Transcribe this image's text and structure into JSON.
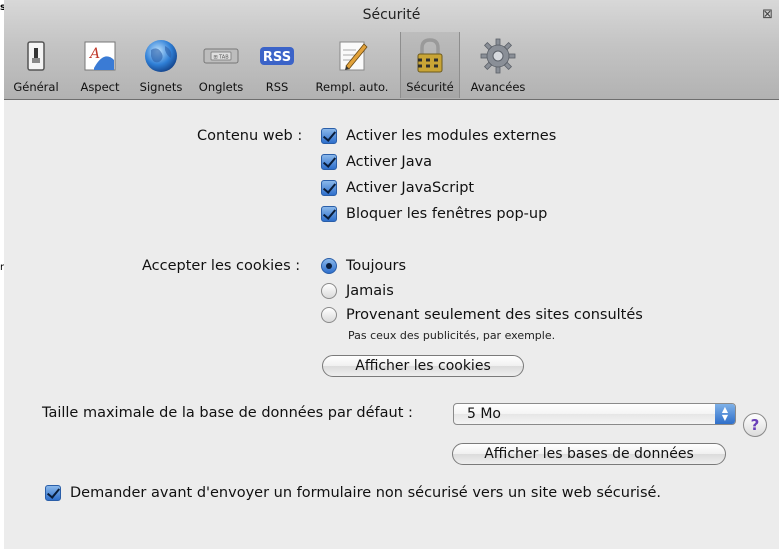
{
  "window": {
    "title": "Sécurité"
  },
  "edge": {
    "char1": "s",
    "char2": "r"
  },
  "toolbar": {
    "items": [
      {
        "label": "Général",
        "icon": "general-switch-icon"
      },
      {
        "label": "Aspect",
        "icon": "aspect-font-icon"
      },
      {
        "label": "Signets",
        "icon": "globe-icon"
      },
      {
        "label": "Onglets",
        "icon": "tabs-icon"
      },
      {
        "label": "RSS",
        "icon": "rss-icon"
      },
      {
        "label": "Rempl. auto.",
        "icon": "pencil-form-icon"
      },
      {
        "label": "Sécurité",
        "icon": "lock-icon",
        "selected": true
      },
      {
        "label": "Avancées",
        "icon": "gear-icon"
      }
    ],
    "rss_badge": "RSS",
    "tab_badge": "⊞ TAB"
  },
  "web_content": {
    "label": "Contenu web :",
    "options": [
      {
        "label": "Activer les modules externes",
        "checked": true
      },
      {
        "label": "Activer Java",
        "checked": true
      },
      {
        "label": "Activer JavaScript",
        "checked": true
      },
      {
        "label": "Bloquer les fenêtres pop-up",
        "checked": true
      }
    ]
  },
  "cookies": {
    "label": "Accepter les cookies :",
    "options": [
      {
        "label": "Toujours",
        "selected": true
      },
      {
        "label": "Jamais",
        "selected": false
      },
      {
        "label": "Provenant seulement des sites consultés",
        "selected": false
      }
    ],
    "note": "Pas ceux des publicités, par exemple.",
    "show_button": "Afficher les cookies"
  },
  "database": {
    "label": "Taille maximale de la base de données par défaut :",
    "selected_value": "5 Mo",
    "show_button": "Afficher les bases de données"
  },
  "insecure_form": {
    "label": "Demander avant d'envoyer un formulaire non sécurisé vers un site web sécurisé.",
    "checked": true
  },
  "help": {
    "label": "?"
  },
  "colors": {
    "accent_blue": "#2e6fcc",
    "window_bg": "#ececec",
    "help_purple": "#6a3fb8"
  }
}
